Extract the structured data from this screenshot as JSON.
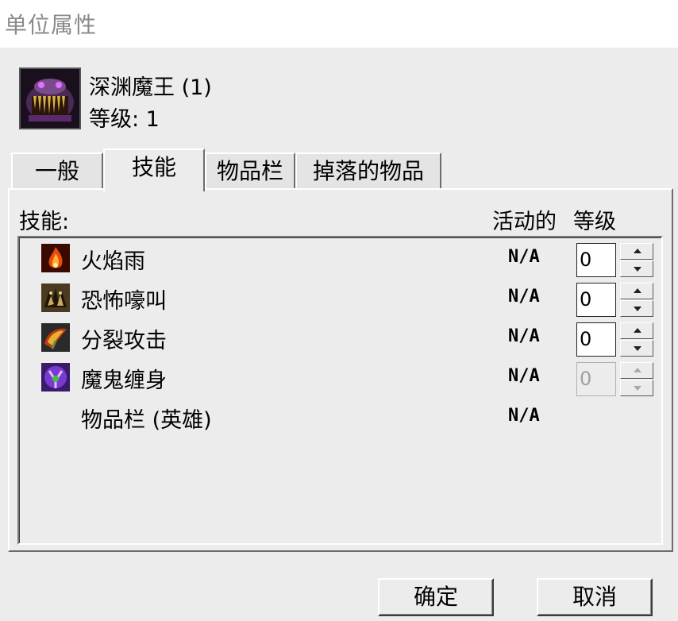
{
  "window": {
    "title": "单位属性"
  },
  "unit": {
    "name": "深渊魔王 (1)",
    "level": "等级: 1"
  },
  "tabs": [
    {
      "label": "一般",
      "active": false
    },
    {
      "label": "技能",
      "active": true
    },
    {
      "label": "物品栏",
      "active": false
    },
    {
      "label": "掉落的物品",
      "active": false
    }
  ],
  "skills_panel": {
    "col_skill": "技能:",
    "col_active": "活动的",
    "col_level": "等级",
    "rows": [
      {
        "name": "火焰雨",
        "active": "N/A",
        "level": "0",
        "enabled": true,
        "icon": "fire-rain-icon"
      },
      {
        "name": "恐怖嚎叫",
        "active": "N/A",
        "level": "0",
        "enabled": true,
        "icon": "howl-of-terror-icon"
      },
      {
        "name": "分裂攻击",
        "active": "N/A",
        "level": "0",
        "enabled": true,
        "icon": "cleaving-attack-icon"
      },
      {
        "name": "魔鬼缠身",
        "active": "N/A",
        "level": "0",
        "enabled": false,
        "icon": "doom-icon"
      },
      {
        "name": "物品栏 (英雄)",
        "active": "N/A"
      }
    ]
  },
  "buttons": {
    "ok": "确定",
    "cancel": "取消"
  }
}
